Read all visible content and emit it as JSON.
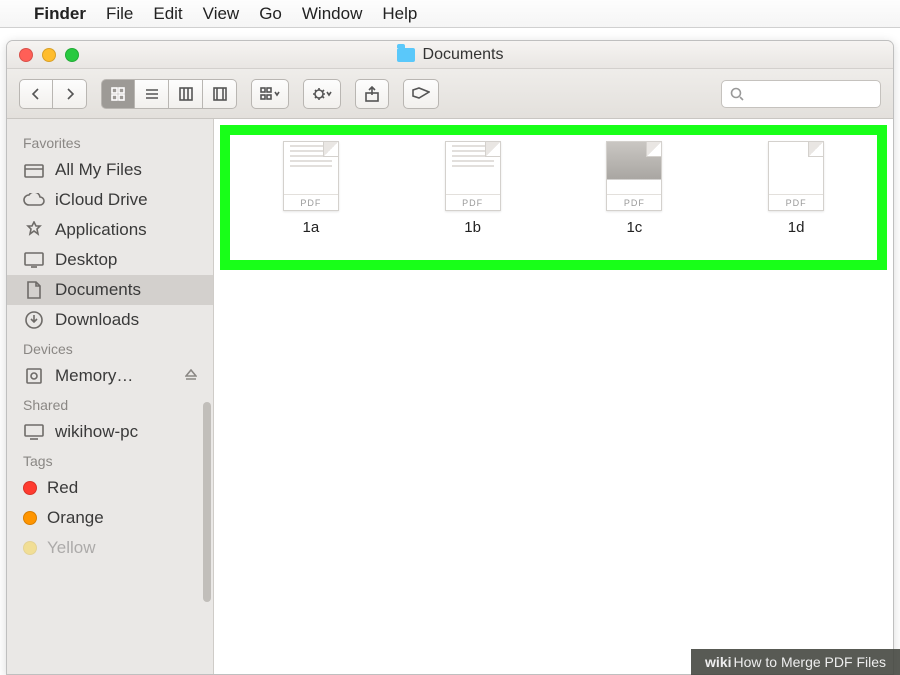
{
  "menubar": {
    "app": "Finder",
    "items": [
      "File",
      "Edit",
      "View",
      "Go",
      "Window",
      "Help"
    ]
  },
  "window": {
    "title": "Documents"
  },
  "sidebar": {
    "favorites_header": "Favorites",
    "favorites": [
      {
        "id": "all-my-files",
        "label": "All My Files"
      },
      {
        "id": "icloud-drive",
        "label": "iCloud Drive"
      },
      {
        "id": "applications",
        "label": "Applications"
      },
      {
        "id": "desktop",
        "label": "Desktop"
      },
      {
        "id": "documents",
        "label": "Documents"
      },
      {
        "id": "downloads",
        "label": "Downloads"
      }
    ],
    "devices_header": "Devices",
    "devices": [
      {
        "id": "memory",
        "label": "Memory…",
        "ejectable": true
      }
    ],
    "shared_header": "Shared",
    "shared": [
      {
        "id": "wikihow-pc",
        "label": "wikihow-pc"
      }
    ],
    "tags_header": "Tags",
    "tags": [
      {
        "id": "red",
        "label": "Red",
        "color": "#ff3b30"
      },
      {
        "id": "orange",
        "label": "Orange",
        "color": "#ff9500"
      },
      {
        "id": "yellow",
        "label": "Yellow",
        "color": "#ffcc00"
      }
    ]
  },
  "files": [
    {
      "name": "1a",
      "ext": "PDF"
    },
    {
      "name": "1b",
      "ext": "PDF"
    },
    {
      "name": "1c",
      "ext": "PDF"
    },
    {
      "name": "1d",
      "ext": "PDF"
    }
  ],
  "caption": {
    "brand": "wiki",
    "suffix": "How to Merge PDF Files"
  }
}
